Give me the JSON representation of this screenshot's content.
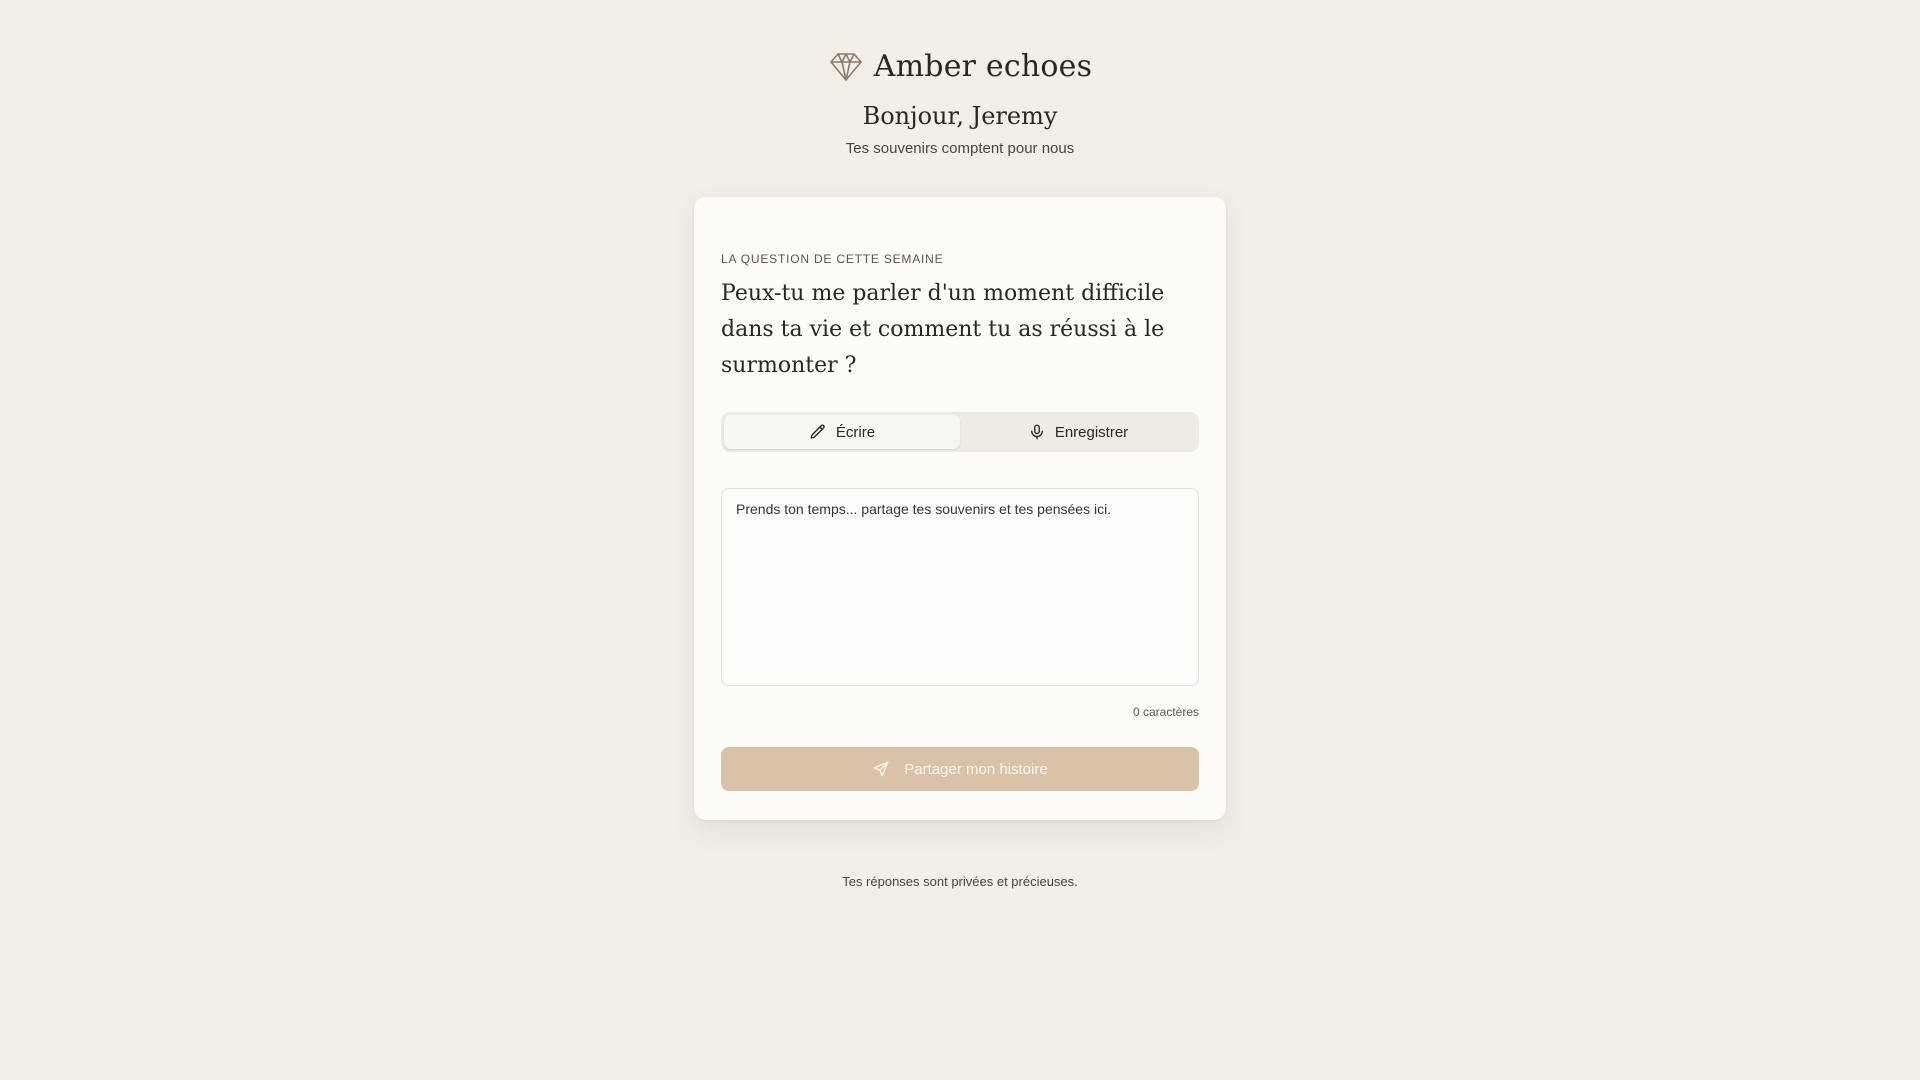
{
  "brand": {
    "name": "Amber echoes",
    "icon": "diamond-icon"
  },
  "header": {
    "greeting": "Bonjour, Jeremy",
    "subtitle": "Tes souvenirs comptent pour nous"
  },
  "card": {
    "section_label": "La question de cette semaine",
    "question": "Peux-tu me parler d'un moment difficile dans ta vie et comment tu as réussi à le surmonter ?",
    "modes": [
      {
        "label": "Écrire",
        "icon": "pencil-icon",
        "active": true
      },
      {
        "label": "Enregistrer",
        "icon": "microphone-icon",
        "active": false
      }
    ],
    "textarea": {
      "placeholder": "Prends ton temps... partage tes souvenirs et tes pensées ici.",
      "value": ""
    },
    "char_count": "0 caractères",
    "submit": {
      "label": "Partager mon histoire",
      "icon": "send-icon",
      "color": "#d9c2a8"
    }
  },
  "footer": {
    "note": "Tes réponses sont privées et précieuses."
  },
  "colors": {
    "background": "#f3efe8",
    "card": "#fdfcf9",
    "accent": "#d9c2a8",
    "text": "#2b2622"
  }
}
